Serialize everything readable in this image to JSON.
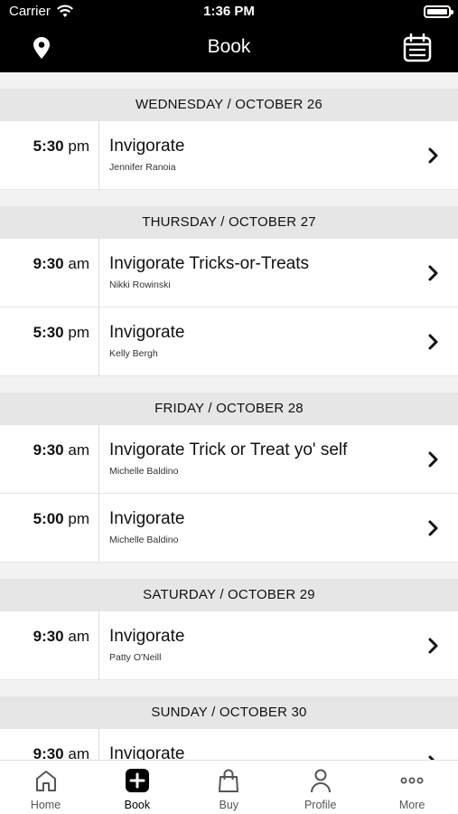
{
  "status_bar": {
    "carrier": "Carrier",
    "time": "1:36 PM"
  },
  "nav": {
    "title": "Book",
    "left_icon": "location-pin-icon",
    "right_icon": "calendar-icon"
  },
  "days": [
    {
      "header": "WEDNESDAY / OCTOBER 26",
      "classes": [
        {
          "time": "5:30",
          "ampm": "pm",
          "name": "Invigorate",
          "instructor": "Jennifer Ranoia"
        }
      ]
    },
    {
      "header": "THURSDAY / OCTOBER 27",
      "classes": [
        {
          "time": "9:30",
          "ampm": "am",
          "name": "Invigorate Tricks-or-Treats",
          "instructor": "Nikki Rowinski"
        },
        {
          "time": "5:30",
          "ampm": "pm",
          "name": "Invigorate",
          "instructor": "Kelly Bergh"
        }
      ]
    },
    {
      "header": "FRIDAY / OCTOBER 28",
      "classes": [
        {
          "time": "9:30",
          "ampm": "am",
          "name": "Invigorate Trick or Treat yo' self",
          "instructor": "Michelle Baldino"
        },
        {
          "time": "5:00",
          "ampm": "pm",
          "name": "Invigorate",
          "instructor": "Michelle Baldino"
        }
      ]
    },
    {
      "header": "SATURDAY / OCTOBER 29",
      "classes": [
        {
          "time": "9:30",
          "ampm": "am",
          "name": "Invigorate",
          "instructor": "Patty O'Neill"
        }
      ]
    },
    {
      "header": "SUNDAY / OCTOBER 30",
      "classes": [
        {
          "time": "9:30",
          "ampm": "am",
          "name": "Invigorate",
          "instructor": ""
        }
      ]
    }
  ],
  "tabs": [
    {
      "label": "Home",
      "icon": "home-icon",
      "active": false
    },
    {
      "label": "Book",
      "icon": "book-plus-icon",
      "active": true
    },
    {
      "label": "Buy",
      "icon": "shopping-bag-icon",
      "active": false
    },
    {
      "label": "Profile",
      "icon": "profile-icon",
      "active": false
    },
    {
      "label": "More",
      "icon": "more-dots-icon",
      "active": false
    }
  ]
}
